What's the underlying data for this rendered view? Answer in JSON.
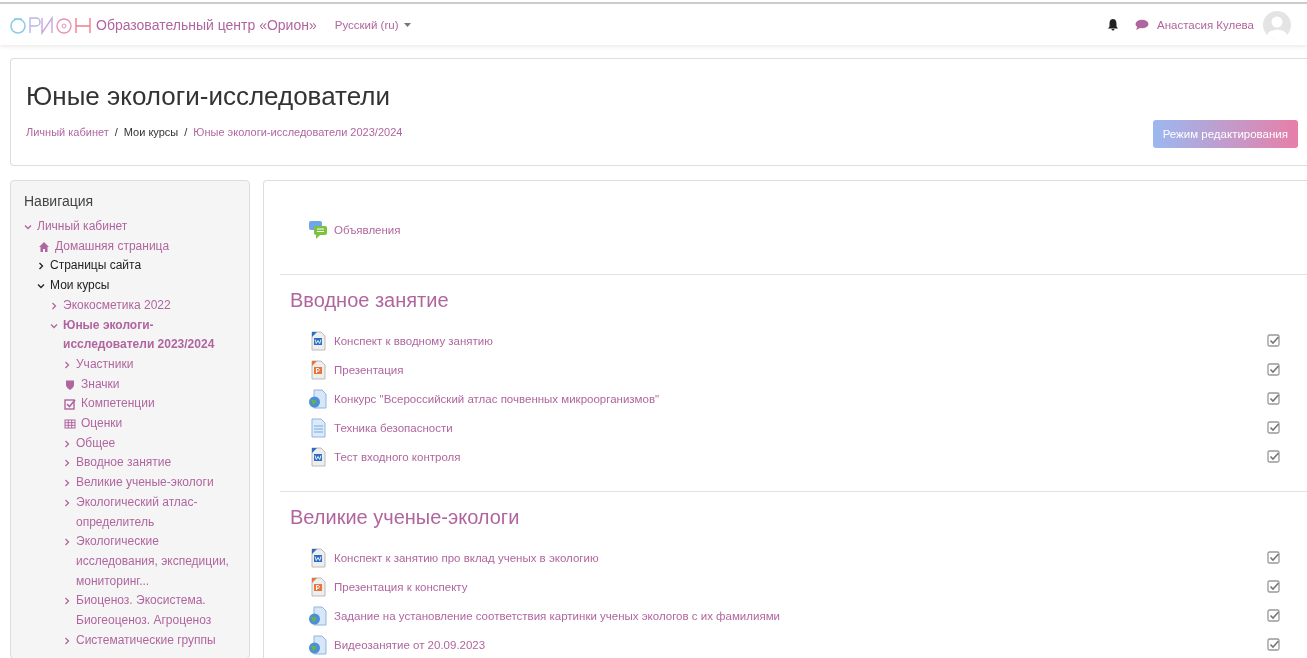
{
  "navbar": {
    "site_name": "Образовательный центр «Орион»",
    "language": "Русский (ru)",
    "user_name": "Анастасия Кулева"
  },
  "page_header": {
    "title": "Юные экологи-исследователи",
    "breadcrumb": [
      {
        "label": "Личный кабинет",
        "kind": "link"
      },
      {
        "label": "/",
        "kind": "separator"
      },
      {
        "label": "Мои курсы",
        "kind": "plain"
      },
      {
        "label": "/",
        "kind": "separator"
      },
      {
        "label": "Юные экологи-исследователи 2023/2024",
        "kind": "link"
      }
    ],
    "edit_button": "Режим редактирования"
  },
  "navigation": {
    "title": "Навигация",
    "items": [
      {
        "label": "Личный кабинет",
        "kind": "link",
        "expanded": true,
        "children": [
          {
            "label": "Домашняя страница",
            "kind": "home"
          },
          {
            "label": "Страницы сайта",
            "kind": "branch",
            "expanded": false
          },
          {
            "label": "Мои курсы",
            "kind": "branch",
            "expanded": true,
            "children": [
              {
                "label": "Экокосметика 2022",
                "kind": "link",
                "expanded": false
              },
              {
                "label": "Юные экологи-исследователи 2023/2024",
                "kind": "link",
                "expanded": true,
                "current": true,
                "children": [
                  {
                    "label": "Участники",
                    "kind": "link",
                    "expanded": false
                  },
                  {
                    "label": "Значки",
                    "kind": "badge"
                  },
                  {
                    "label": "Компетенции",
                    "kind": "competency"
                  },
                  {
                    "label": "Оценки",
                    "kind": "grades"
                  },
                  {
                    "label": "Общее",
                    "kind": "link",
                    "expanded": false
                  },
                  {
                    "label": "Вводное занятие",
                    "kind": "link",
                    "expanded": false
                  },
                  {
                    "label": "Великие ученые-экологи",
                    "kind": "link",
                    "expanded": false
                  },
                  {
                    "label": "Экологический атлас-определитель",
                    "kind": "link",
                    "expanded": false
                  },
                  {
                    "label": "Экологические исследования, экспедиции, мониторинг...",
                    "kind": "link",
                    "expanded": false
                  },
                  {
                    "label": "Биоценоз. Экосистема. Биогеоценоз. Агроценоз",
                    "kind": "link",
                    "expanded": false
                  },
                  {
                    "label": "Систематические группы",
                    "kind": "link",
                    "expanded": false
                  }
                ]
              }
            ]
          }
        ]
      }
    ]
  },
  "sections": [
    {
      "activities": [
        {
          "label": "Объявления",
          "kind": "forum"
        }
      ]
    },
    {
      "title": "Вводное занятие",
      "activities": [
        {
          "label": "Конспект к вводному занятию",
          "kind": "word",
          "checked": true
        },
        {
          "label": "Презентация",
          "kind": "powerpoint",
          "checked": true
        },
        {
          "label": "Конкурс \"Всероссийский атлас почвенных микроорганизмов\"",
          "kind": "url",
          "checked": true
        },
        {
          "label": "Техника безопасности",
          "kind": "page",
          "checked": true
        },
        {
          "label": "Тест входного контроля",
          "kind": "word",
          "checked": true
        }
      ]
    },
    {
      "title": "Великие ученые-экологи",
      "activities": [
        {
          "label": "Конспект к занятию про вклад ученых в экологию",
          "kind": "word",
          "checked": true
        },
        {
          "label": "Презентация к конспекту",
          "kind": "powerpoint",
          "checked": true
        },
        {
          "label": "Задание на установление соответствия картинки ученых экологов с их фамилиями",
          "kind": "url",
          "checked": true
        },
        {
          "label": "Видеозанятие от 20.09.2023",
          "kind": "url",
          "checked": true
        }
      ]
    }
  ]
}
